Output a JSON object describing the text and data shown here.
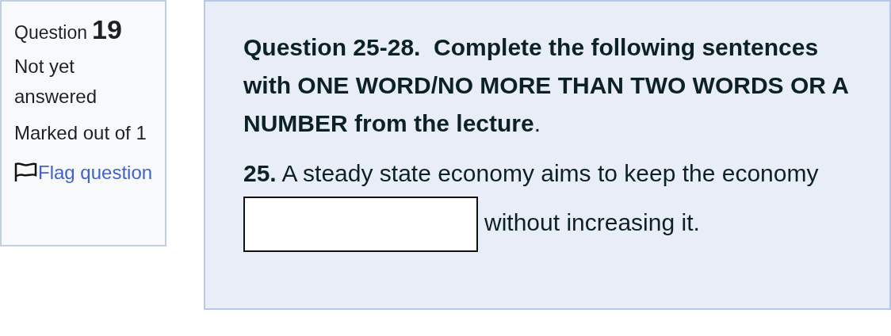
{
  "info": {
    "label": "Question",
    "number": "19",
    "status": "Not yet answered",
    "marks": "Marked out of 1",
    "flag": {
      "label": "Flag question",
      "flagged": false
    }
  },
  "content": {
    "instructions": "**Question 25-28.  Complete the following sentences with ONE WORD/NO MORE THAN TWO WORDS OR A NUMBER from the lecture**.",
    "prompt_before": "**25.** A steady state economy aims to keep the economy",
    "prompt_after": "without increasing it."
  }
}
